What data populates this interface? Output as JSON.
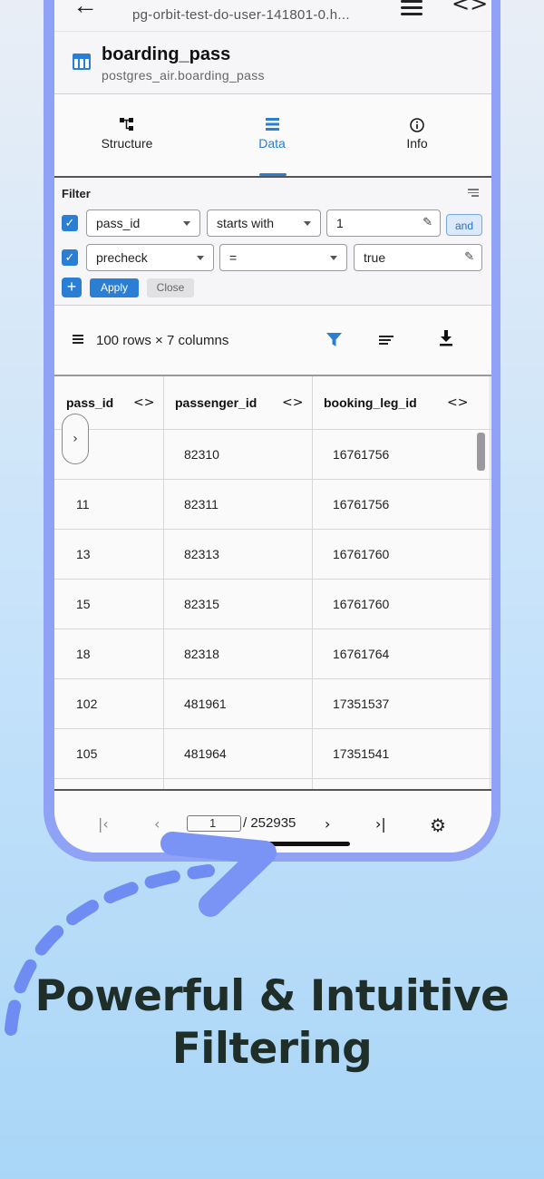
{
  "topbar": {
    "host": "pg-orbit-test-do-user-141801-0.h...",
    "icons": [
      "back-arrow-icon",
      "menu-icon",
      "code-icon"
    ]
  },
  "table": {
    "name": "boarding_pass",
    "schema_path": "postgres_air.boarding_pass"
  },
  "tabs": [
    {
      "label": "Structure",
      "icon": "structure-icon",
      "active": false
    },
    {
      "label": "Data",
      "icon": "list-icon",
      "active": true
    },
    {
      "label": "Info",
      "icon": "info-icon",
      "active": false
    }
  ],
  "filter": {
    "label": "Filter",
    "rows": [
      {
        "checked": true,
        "column": "pass_id",
        "operator": "starts with",
        "value": "1"
      },
      {
        "checked": true,
        "column": "precheck",
        "operator": "=",
        "value": "true"
      }
    ],
    "conjunction": "and",
    "apply_label": "Apply",
    "close_label": "Close",
    "add_label": "+"
  },
  "summary": {
    "text": "100 rows × 7 columns"
  },
  "grid": {
    "columns": [
      "pass_id",
      "passenger_id",
      "booking_leg_id"
    ],
    "rows": [
      [
        "",
        "82310",
        "16761756"
      ],
      [
        "11",
        "82311",
        "16761756"
      ],
      [
        "13",
        "82313",
        "16761760"
      ],
      [
        "15",
        "82315",
        "16761760"
      ],
      [
        "18",
        "82318",
        "16761764"
      ],
      [
        "102",
        "481961",
        "17351537"
      ],
      [
        "105",
        "481964",
        "17351541"
      ]
    ]
  },
  "pager": {
    "current_page": "1",
    "total": "/ 252935"
  },
  "marketing": {
    "line1": "Powerful & Intuitive",
    "line2": "Filtering"
  },
  "colors": {
    "accent": "#2a7ed3",
    "frame": "#8fa2f6",
    "headline": "#1f2e28"
  }
}
